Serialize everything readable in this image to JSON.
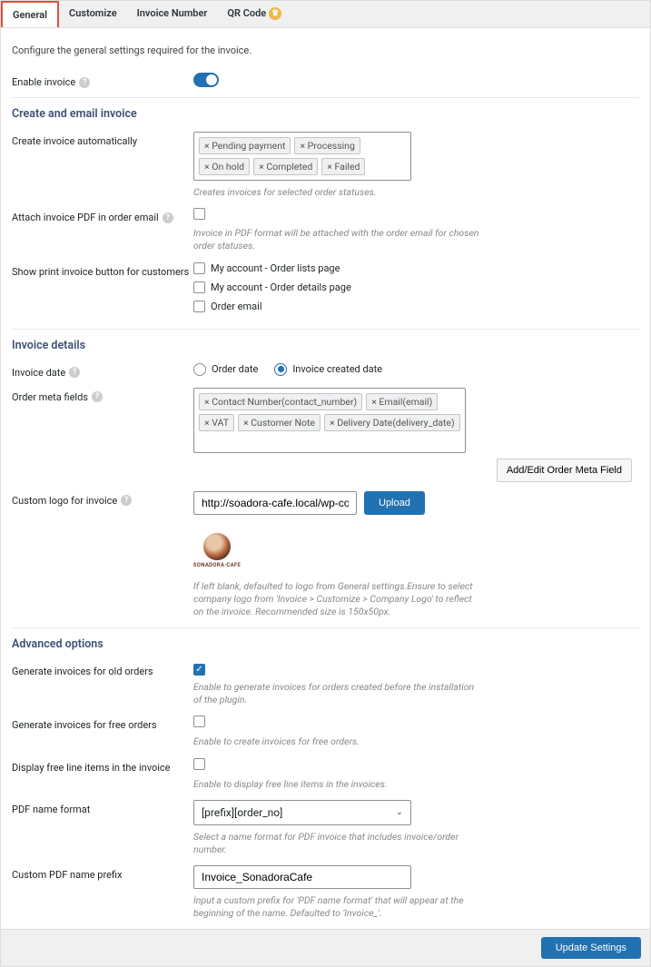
{
  "tabs": {
    "general": "General",
    "customize": "Customize",
    "invoice_number": "Invoice Number",
    "qr_code": "QR Code"
  },
  "intro": "Configure the general settings required for the invoice.",
  "enable_invoice_label": "Enable invoice",
  "sections": {
    "create_email": "Create and email invoice",
    "invoice_details": "Invoice details",
    "advanced": "Advanced options"
  },
  "create_auto": {
    "label": "Create invoice automatically",
    "tags": [
      "Pending payment",
      "Processing",
      "On hold",
      "Completed",
      "Failed"
    ],
    "desc": "Creates invoices for selected order statuses."
  },
  "attach_pdf": {
    "label": "Attach invoice PDF in order email",
    "desc": "Invoice in PDF format will be attached with the order email for chosen order statuses."
  },
  "show_print": {
    "label": "Show print invoice button for customers",
    "opt1": "My account - Order lists page",
    "opt2": "My account - Order details page",
    "opt3": "Order email"
  },
  "invoice_date": {
    "label": "Invoice date",
    "opt1": "Order date",
    "opt2": "Invoice created date"
  },
  "order_meta": {
    "label": "Order meta fields",
    "tags": [
      "Contact Number(contact_number)",
      "Email(email)",
      "VAT",
      "Customer Note",
      "Delivery Date(delivery_date)"
    ],
    "button": "Add/Edit Order Meta Field"
  },
  "custom_logo": {
    "label": "Custom logo for invoice",
    "url": "http://soadora-cafe.local/wp-content/up",
    "upload": "Upload",
    "logo_caption": "SONADORA·CAFE",
    "desc": "If left blank, defaulted to logo from General settings.Ensure to select company logo from 'Invoice > Customize > Company Logo' to reflect on the invoice. Recommended size is 150x50px."
  },
  "gen_old": {
    "label": "Generate invoices for old orders",
    "desc": "Enable to generate invoices for orders created before the installation of the plugin."
  },
  "gen_free": {
    "label": "Generate invoices for free orders",
    "desc": "Enable to create invoices for free orders."
  },
  "display_free": {
    "label": "Display free line items in the invoice",
    "desc": "Enable to display free line items in the invoices."
  },
  "pdf_name": {
    "label": "PDF name format",
    "value": "[prefix][order_no]",
    "desc": "Select a name format for PDF invoice that includes invoice/order number."
  },
  "pdf_prefix": {
    "label": "Custom PDF name prefix",
    "value": "Invoice_SonadoraCafe",
    "desc": "Input a custom prefix for 'PDF name format' that will appear at the beginning of the name. Defaulted to 'Invoice_'."
  },
  "footer": {
    "update": "Update Settings"
  }
}
